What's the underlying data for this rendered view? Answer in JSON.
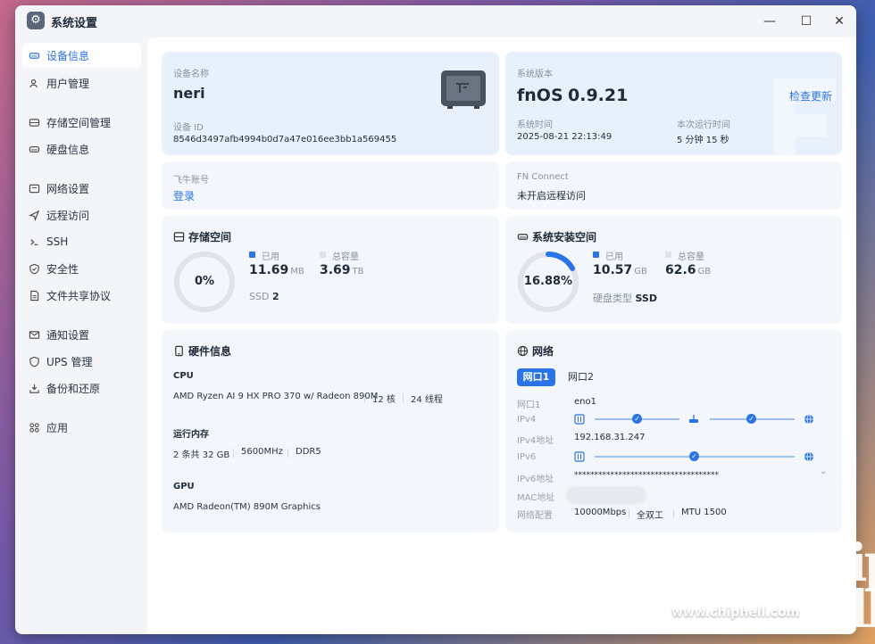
{
  "window": {
    "title": "系统设置"
  },
  "sidebar": {
    "items": [
      {
        "label": "设备信息",
        "icon": "drive-icon",
        "active": true
      },
      {
        "label": "用户管理",
        "icon": "users-icon"
      },
      {
        "label": "存储空间管理",
        "icon": "storage-icon"
      },
      {
        "label": "硬盘信息",
        "icon": "disk-icon"
      },
      {
        "label": "网络设置",
        "icon": "network-icon"
      },
      {
        "label": "远程访问",
        "icon": "send-icon"
      },
      {
        "label": "SSH",
        "icon": "terminal-icon"
      },
      {
        "label": "安全性",
        "icon": "shield-icon"
      },
      {
        "label": "文件共享协议",
        "icon": "file-icon"
      },
      {
        "label": "通知设置",
        "icon": "mail-icon"
      },
      {
        "label": "UPS 管理",
        "icon": "power-icon"
      },
      {
        "label": "备份和还原",
        "icon": "backup-icon"
      },
      {
        "label": "应用",
        "icon": "apps-icon"
      }
    ]
  },
  "device": {
    "name_label": "设备名称",
    "name": "neri",
    "id_label": "设备 ID",
    "id": "8546d3497afb4994b0d7a47e016ee3bb1a569455"
  },
  "system": {
    "version_label": "系统版本",
    "os": "fnOS",
    "version": "0.9.21",
    "check_update": "检查更新",
    "time_label": "系统时间",
    "time": "2025-08-21 22:13:49",
    "uptime_label": "本次运行时间",
    "uptime": "5 分钟 15 秒"
  },
  "account": {
    "label": "飞牛账号",
    "login": "登录"
  },
  "fnconnect": {
    "label": "FN Connect",
    "status": "未开启远程访问"
  },
  "storage": {
    "title": "存储空间",
    "percent_text": "0%",
    "percent": 0,
    "used_label": "已用",
    "used": "11.69",
    "used_unit": "MB",
    "total_label": "总容量",
    "total": "3.69",
    "total_unit": "TB",
    "ssd_label": "SSD",
    "ssd_count": "2"
  },
  "sysspace": {
    "title": "系统安装空间",
    "percent_text": "16.88%",
    "percent": 16.88,
    "used_label": "已用",
    "used": "10.57",
    "used_unit": "GB",
    "total_label": "总容量",
    "total": "62.6",
    "total_unit": "GB",
    "disk_type_label": "硬盘类型",
    "disk_type": "SSD"
  },
  "hardware": {
    "title": "硬件信息",
    "cpu_label": "CPU",
    "cpu_model": "AMD Ryzen AI 9 HX PRO 370 w/ Radeon 890M",
    "cpu_cores": "12 核",
    "cpu_threads": "24 线程",
    "mem_label": "运行内存",
    "mem_size": "2 条共 32 GB",
    "mem_speed": "5600MHz",
    "mem_type": "DDR5",
    "gpu_label": "GPU",
    "gpu_model": "AMD Radeon(TM) 890M Graphics"
  },
  "network": {
    "title": "网络",
    "tabs": [
      "网口1",
      "网口2"
    ],
    "port_label": "网口1",
    "port_value": "eno1",
    "ipv4_label": "IPv4",
    "ipv4_addr_label": "IPv4地址",
    "ipv4_addr": "192.168.31.247",
    "ipv6_label": "IPv6",
    "ipv6_addr_label": "IPv6地址",
    "ipv6_addr": "************************************",
    "mac_label": "MAC地址",
    "config_label": "网络配置",
    "speed": "10000Mbps",
    "duplex": "全双工",
    "mtu": "MTU 1500"
  },
  "watermark": {
    "logo": "chip hell",
    "url": "www.chiphell.com"
  },
  "colors": {
    "accent": "#2a73e8",
    "ring_track": "#dfe3ea"
  }
}
